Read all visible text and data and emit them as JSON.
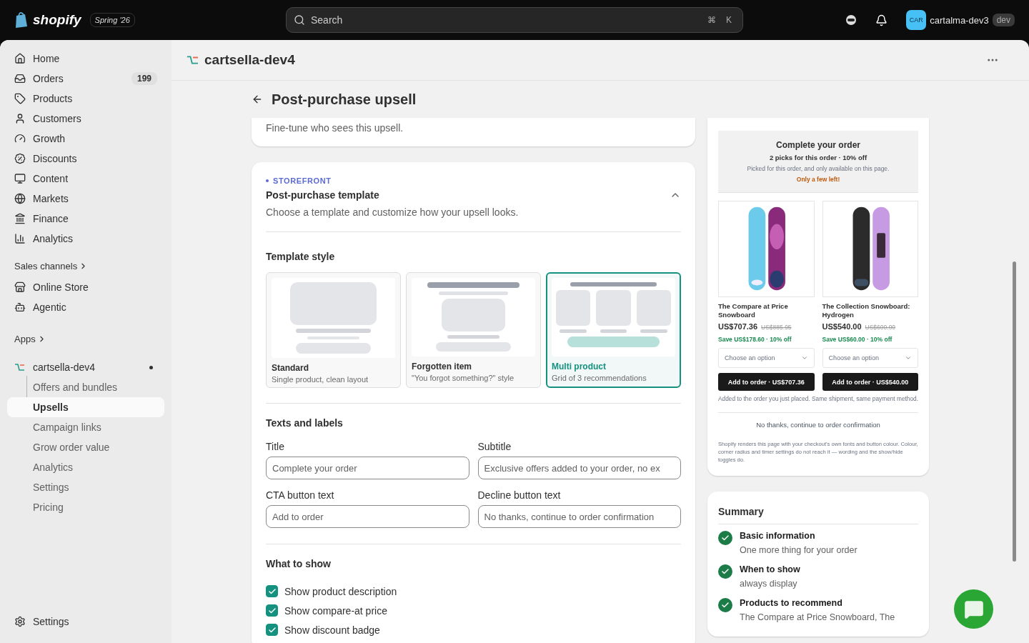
{
  "topbar": {
    "logo_text": "shopify",
    "edition": "Spring '26",
    "search": {
      "placeholder": "Search",
      "keys": [
        "⌘",
        "K"
      ]
    },
    "account": {
      "avatar": "CAR",
      "name": "cartalma-dev3",
      "badge": "dev"
    }
  },
  "sidebar": {
    "items": [
      {
        "label": "Home",
        "selected": false
      },
      {
        "label": "Orders",
        "badge": "199",
        "selected": false
      },
      {
        "label": "Products",
        "selected": false
      },
      {
        "label": "Customers",
        "selected": false
      },
      {
        "label": "Growth",
        "selected": false
      },
      {
        "label": "Discounts",
        "selected": false
      },
      {
        "label": "Content",
        "selected": false
      },
      {
        "label": "Markets",
        "selected": false
      },
      {
        "label": "Finance",
        "selected": false
      },
      {
        "label": "Analytics",
        "selected": false
      }
    ],
    "sales_channels": {
      "heading": "Sales channels",
      "items": [
        {
          "label": "Online Store",
          "selected": false
        },
        {
          "label": "Agentic",
          "selected": false
        }
      ]
    },
    "apps": {
      "heading": "Apps",
      "app": {
        "label": "cartsella-dev4",
        "children": [
          {
            "label": "Offers and bundles",
            "selected": false
          },
          {
            "label": "Upsells",
            "selected": true
          },
          {
            "label": "Campaign links",
            "selected": false
          },
          {
            "label": "Grow order value",
            "selected": false
          },
          {
            "label": "Analytics",
            "selected": false
          },
          {
            "label": "Settings",
            "selected": false
          },
          {
            "label": "Pricing",
            "selected": false
          }
        ]
      }
    },
    "settings": "Settings"
  },
  "page": {
    "store": "cartsella-dev4",
    "title": "Post-purchase upsell"
  },
  "audience_card": {
    "description": "Fine-tune who sees this upsell."
  },
  "template_card": {
    "eyebrow": "STOREFRONT",
    "title": "Post-purchase template",
    "description": "Choose a template and customize how your upsell looks.",
    "expanded": true,
    "style_heading": "Template style",
    "templates": [
      {
        "kind": "standard",
        "name": "Standard",
        "description": "Single product, clean layout",
        "selected": false
      },
      {
        "kind": "forgotten",
        "name": "Forgotten item",
        "description": "\"You forgot something?\" style",
        "selected": false
      },
      {
        "kind": "multi",
        "name": "Multi product",
        "description": "Grid of 3 recommendations",
        "selected": true
      }
    ],
    "texts_heading": "Texts and labels",
    "fields": [
      {
        "label": "Title",
        "value": "Complete your order"
      },
      {
        "label": "Subtitle",
        "value": "Exclusive offers added to your order, no ex"
      },
      {
        "label": "CTA button text",
        "value": "Add to order"
      },
      {
        "label": "Decline button text",
        "value": "No thanks, continue to order confirmation"
      }
    ],
    "show_heading": "What to show",
    "options": [
      {
        "label": "Show product description",
        "checked": true
      },
      {
        "label": "Show compare-at price",
        "checked": true
      },
      {
        "label": "Show discount badge",
        "checked": true
      }
    ]
  },
  "preview": {
    "title": "Complete your order",
    "subtitle": "2 picks for this order · 10% off",
    "note": "Picked for this order, and only available on this page.",
    "urgency": "Only a few left!",
    "products": [
      {
        "name": "The Compare at Price Snowboard",
        "price": "US$707.36",
        "compare_price": "US$885.95",
        "savings": "Save US$178.60 · 10% off",
        "select": "Choose an option",
        "cta": "Add to order · US$707.36"
      },
      {
        "name": "The Collection Snowboard: Hydrogen",
        "price": "US$540.00",
        "compare_price": "US$600.00",
        "savings": "Save US$60.00 · 10% off",
        "select": "Choose an option",
        "cta": "Add to order · US$540.00"
      }
    ],
    "footnote": "Added to the order you just placed. Same shipment, same payment method.",
    "decline": "No thanks, continue to order confirmation",
    "disclaimer": "Shopify renders this page with your checkout's own fonts and button colour. Colour, corner radius and timer settings do not reach it — wording and the show/hide toggles do."
  },
  "summary": {
    "title": "Summary",
    "steps": [
      {
        "title": "Basic information",
        "detail": "One more thing for your order",
        "done": true
      },
      {
        "title": "When to show",
        "detail": "always display",
        "done": true
      },
      {
        "title": "Products to recommend",
        "detail": "The Compare at Price Snowboard, The",
        "done": true
      }
    ]
  }
}
